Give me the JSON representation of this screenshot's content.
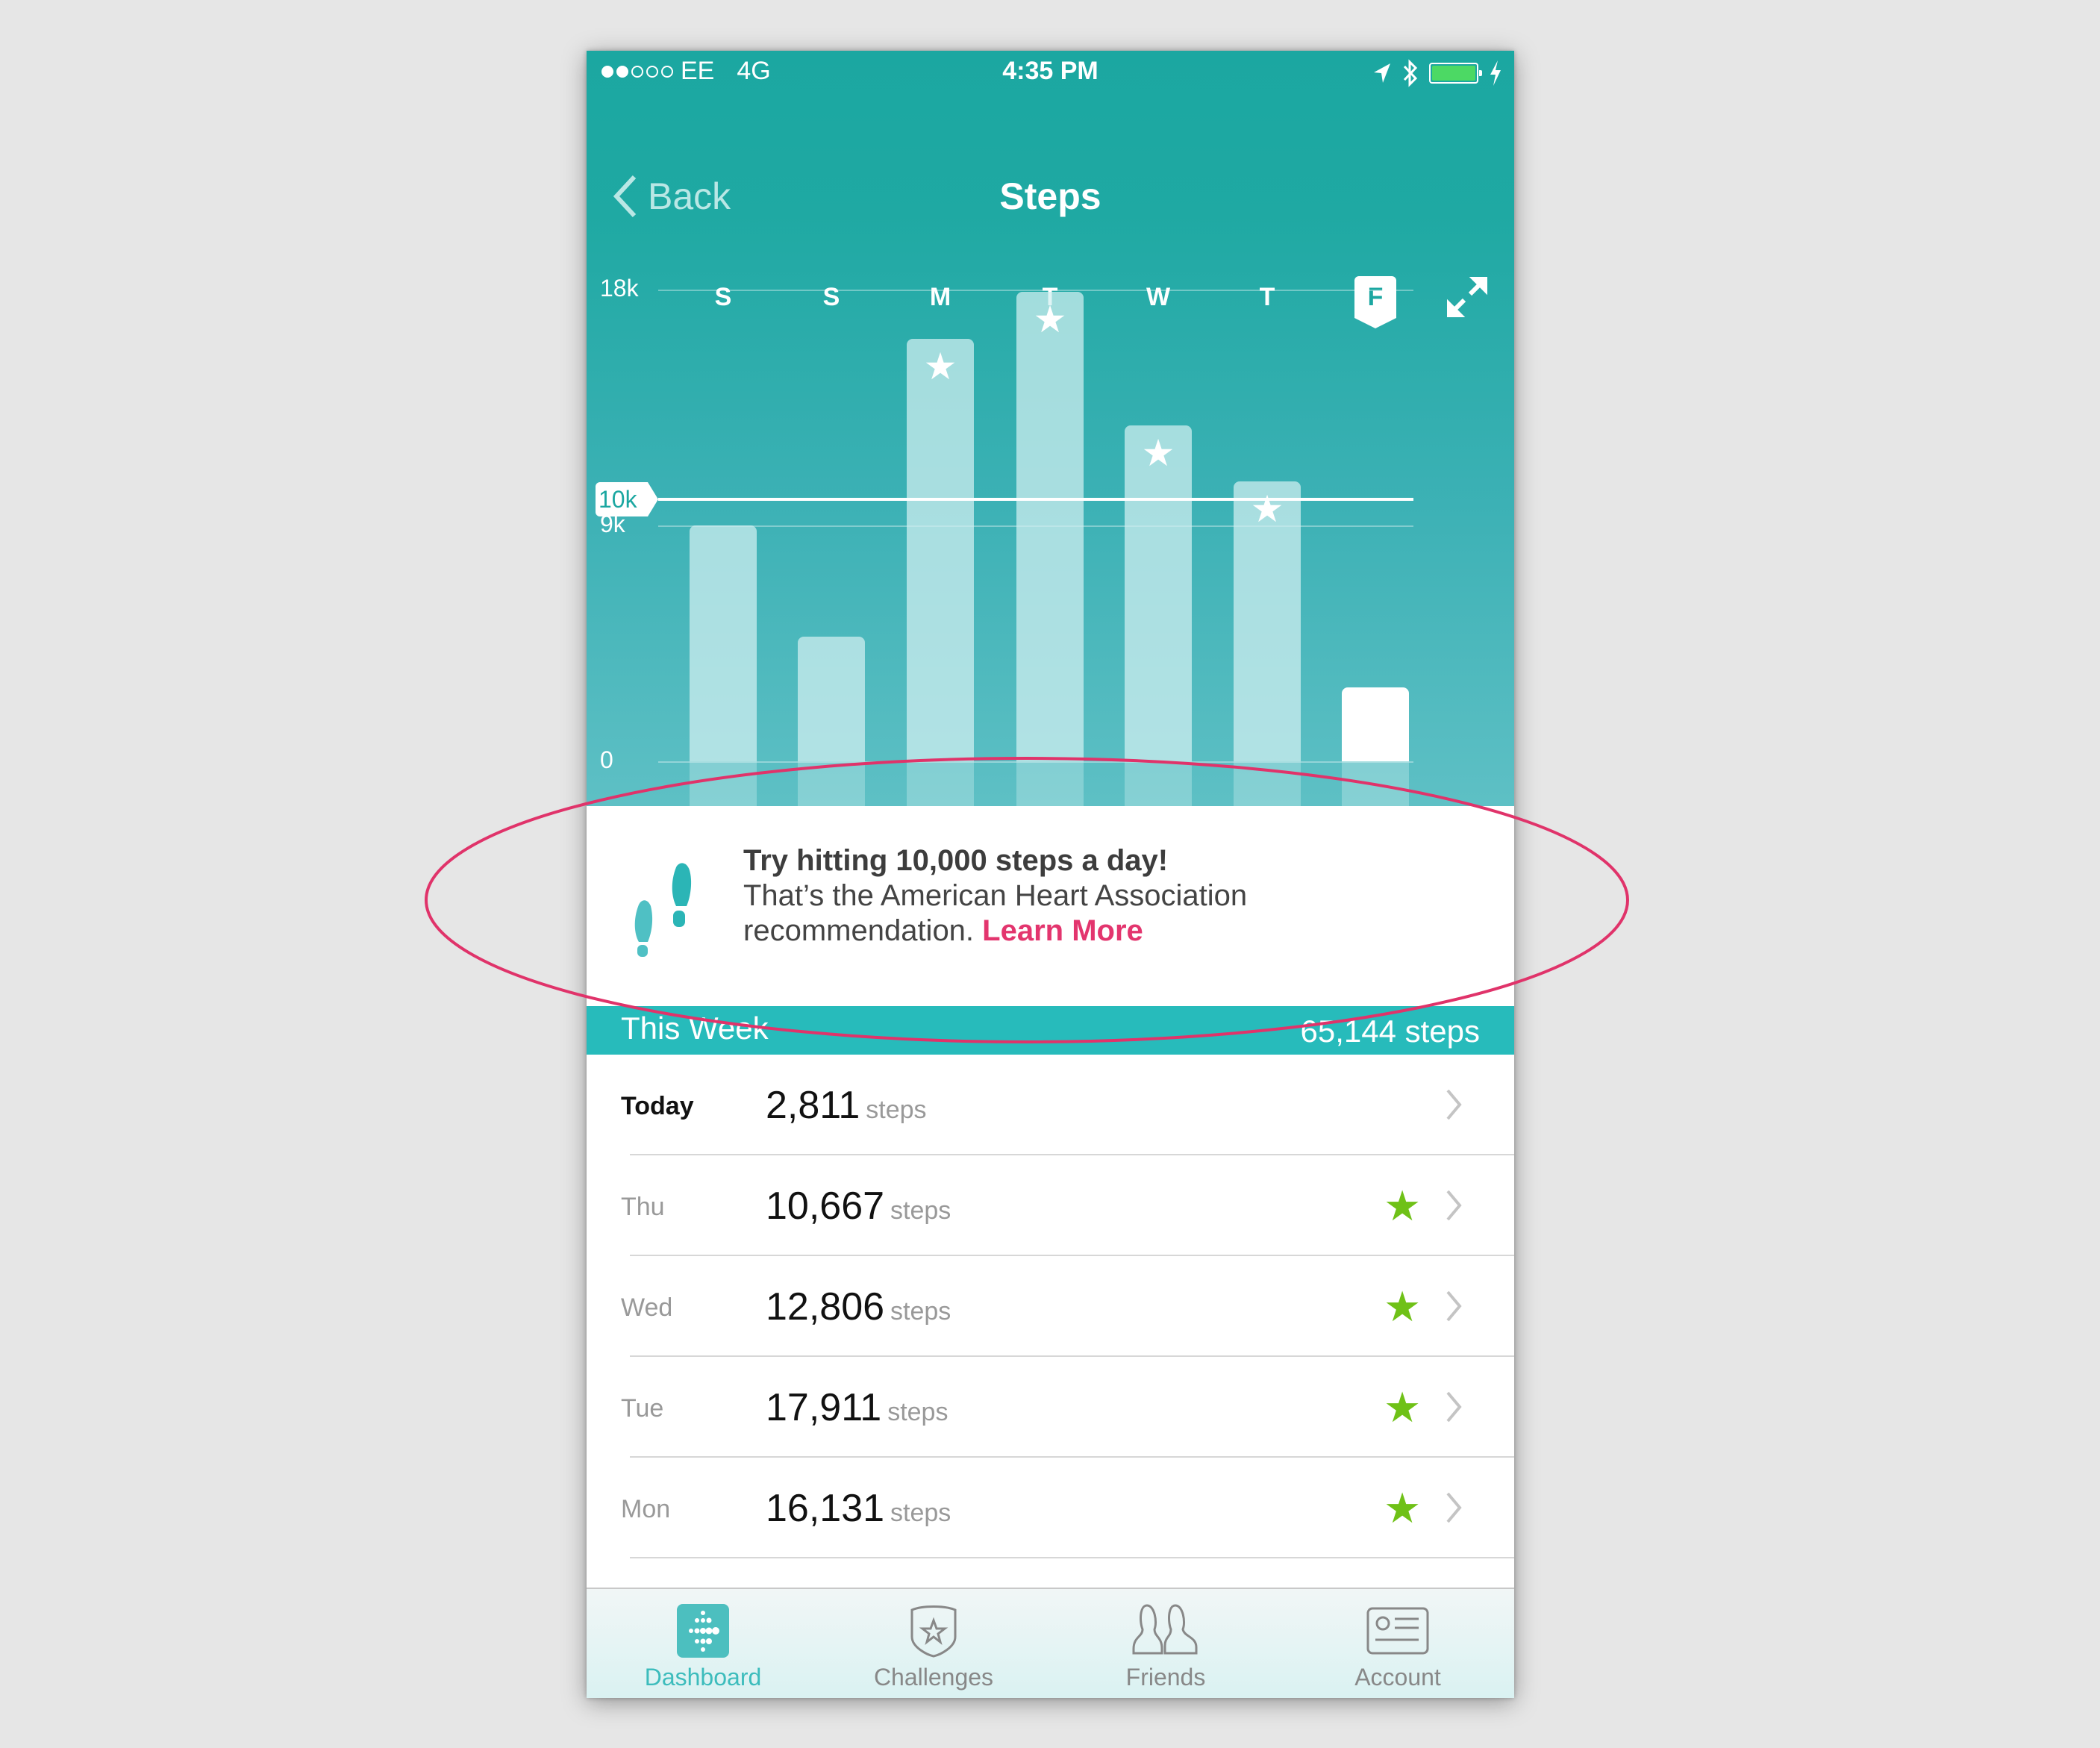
{
  "status_bar": {
    "signal_filled": 2,
    "signal_total": 5,
    "carrier": "EE",
    "network": "4G",
    "time": "4:35 PM",
    "icons": [
      "location-arrow-icon",
      "bluetooth-icon",
      "battery-icon",
      "charging-bolt-icon"
    ],
    "battery_color": "#4cd964"
  },
  "nav": {
    "back_label": "Back",
    "title": "Steps"
  },
  "chart_data": {
    "type": "bar",
    "title": "",
    "xlabel": "",
    "ylabel": "",
    "categories": [
      "S",
      "S",
      "M",
      "T",
      "W",
      "T",
      "F"
    ],
    "selected_category": "F",
    "values": [
      9000,
      4750,
      16131,
      17911,
      12806,
      10667,
      2811
    ],
    "goal_met": [
      false,
      false,
      true,
      true,
      true,
      true,
      false
    ],
    "ylim": [
      0,
      18000
    ],
    "yticks": [
      {
        "value": 18000,
        "label": "18k"
      },
      {
        "value": 9000,
        "label": "9k"
      },
      {
        "value": 0,
        "label": "0"
      }
    ],
    "goal": {
      "value": 10000,
      "label": "10k"
    },
    "grid": true,
    "legend": "none"
  },
  "tip": {
    "headline": "Try hitting 10,000 steps a day!",
    "body": "That’s the American Heart Association recommendation.",
    "link": "Learn More"
  },
  "week_summary": {
    "label": "This Week",
    "total": "65,144 steps"
  },
  "rows": [
    {
      "day": "Today",
      "steps": "2,811",
      "unit": "steps",
      "goal_met": false
    },
    {
      "day": "Thu",
      "steps": "10,667",
      "unit": "steps",
      "goal_met": true
    },
    {
      "day": "Wed",
      "steps": "12,806",
      "unit": "steps",
      "goal_met": true
    },
    {
      "day": "Tue",
      "steps": "17,911",
      "unit": "steps",
      "goal_met": true
    },
    {
      "day": "Mon",
      "steps": "16,131",
      "unit": "steps",
      "goal_met": true
    }
  ],
  "tabs": [
    {
      "label": "Dashboard",
      "icon": "dashboard-icon",
      "active": true
    },
    {
      "label": "Challenges",
      "icon": "challenges-badge-icon",
      "active": false
    },
    {
      "label": "Friends",
      "icon": "friends-icon",
      "active": false
    },
    {
      "label": "Account",
      "icon": "account-card-icon",
      "active": false
    }
  ],
  "colors": {
    "brand_teal": "#1ba7a1",
    "week_bar": "#27bbbb",
    "link_pink": "#e3356e",
    "goal_star_green": "#6fc117",
    "annotation_ellipse": "#e0336a"
  }
}
